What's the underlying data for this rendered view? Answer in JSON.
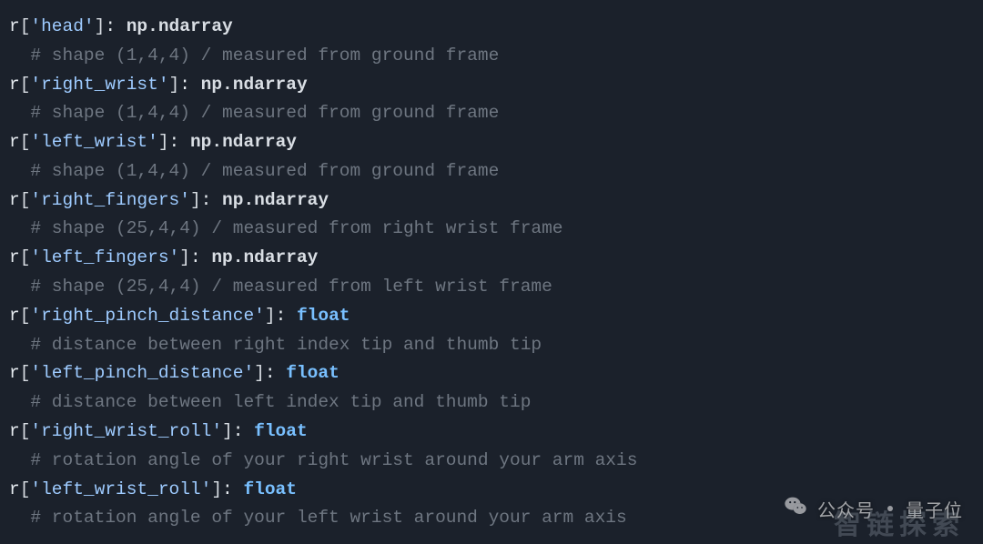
{
  "entries": [
    {
      "key": "head",
      "type": "np.ndarray",
      "comment": "shape (1,4,4) / measured from ground frame"
    },
    {
      "key": "right_wrist",
      "type": "np.ndarray",
      "comment": "shape (1,4,4) / measured from ground frame"
    },
    {
      "key": "left_wrist",
      "type": "np.ndarray",
      "comment": "shape (1,4,4) / measured from ground frame"
    },
    {
      "key": "right_fingers",
      "type": "np.ndarray",
      "comment": "shape (25,4,4) / measured from right wrist frame"
    },
    {
      "key": "left_fingers",
      "type": "np.ndarray",
      "comment": "shape (25,4,4) / measured from left wrist frame"
    },
    {
      "key": "right_pinch_distance",
      "type": "float",
      "comment": "distance between right index tip and thumb tip"
    },
    {
      "key": "left_pinch_distance",
      "type": "float",
      "comment": "distance between left index tip and thumb tip"
    },
    {
      "key": "right_wrist_roll",
      "type": "float",
      "comment": "rotation angle of your right wrist around your arm axis"
    },
    {
      "key": "left_wrist_roll",
      "type": "float",
      "comment": "rotation angle of your left wrist around your arm axis"
    }
  ],
  "watermark": {
    "label_prefix": "公众号",
    "label_suffix": "量子位",
    "overlay": "智链探索"
  }
}
